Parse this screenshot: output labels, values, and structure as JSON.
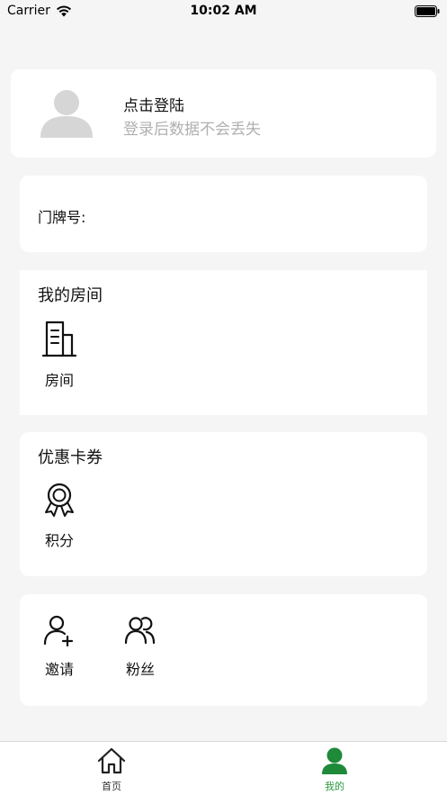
{
  "status_bar": {
    "carrier": "Carrier",
    "time": "10:02 AM"
  },
  "login": {
    "title": "点击登陆",
    "subtitle": "登录后数据不会丢失"
  },
  "door": {
    "label": "门牌号:"
  },
  "rooms": {
    "title": "我的房间",
    "items": [
      {
        "label": "房间",
        "icon": "building-icon"
      }
    ]
  },
  "coupons": {
    "title": "优惠卡券",
    "items": [
      {
        "label": "积分",
        "icon": "award-icon"
      }
    ]
  },
  "social": {
    "items": [
      {
        "label": "邀请",
        "icon": "add-user-icon"
      },
      {
        "label": "粉丝",
        "icon": "users-icon"
      }
    ]
  },
  "tabs": [
    {
      "label": "首页",
      "icon": "home-icon",
      "active": false
    },
    {
      "label": "我的",
      "icon": "person-icon",
      "active": true
    }
  ],
  "colors": {
    "accent": "#2b9a3e",
    "background": "#f5f5f5"
  }
}
